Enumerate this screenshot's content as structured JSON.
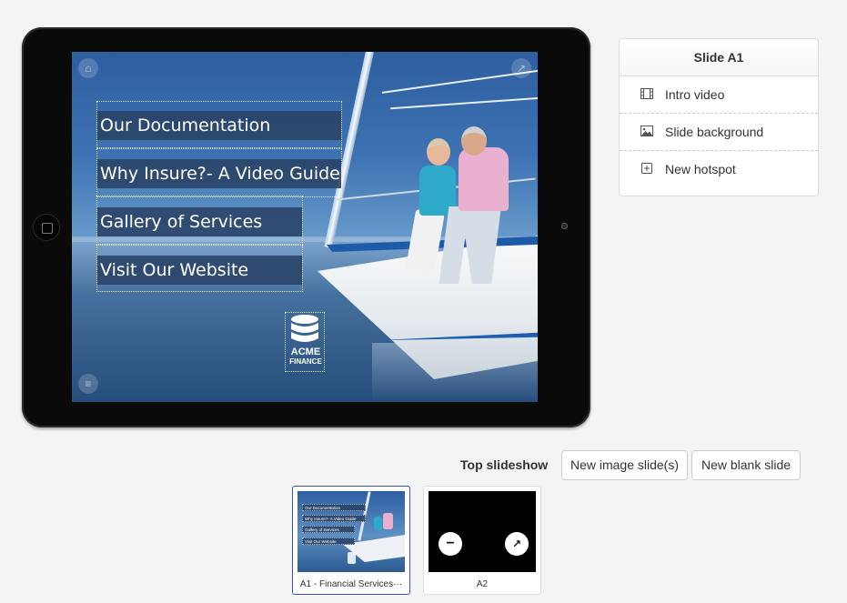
{
  "slide_preview": {
    "menu_items": [
      {
        "label": "Our Documentation"
      },
      {
        "label": "Why Insure?- A Video Guide"
      },
      {
        "label": "Gallery of Services"
      },
      {
        "label": "Visit Our Website"
      }
    ],
    "logo": {
      "line1": "ACME",
      "line2": "FINANCE"
    },
    "icons": {
      "home": "home-icon",
      "share": "share-icon",
      "menu": "menu-icon"
    }
  },
  "panel": {
    "title": "Slide A1",
    "items": [
      {
        "label": "Intro video",
        "icon": "film-icon"
      },
      {
        "label": "Slide background",
        "icon": "image-icon"
      },
      {
        "label": "New hotspot",
        "icon": "plus-square-icon"
      }
    ]
  },
  "toolbar": {
    "label": "Top slideshow",
    "new_image_label": "New image slide(s)",
    "new_blank_label": "New blank slide"
  },
  "thumbnails": [
    {
      "caption": "A1 - Financial Services···",
      "active": true,
      "menu_items": [
        "Our Documentation",
        "Why Insure?- A Video Guide",
        "Gallery of Services",
        "Visit Our Website"
      ]
    },
    {
      "caption": "A2",
      "active": false
    }
  ]
}
